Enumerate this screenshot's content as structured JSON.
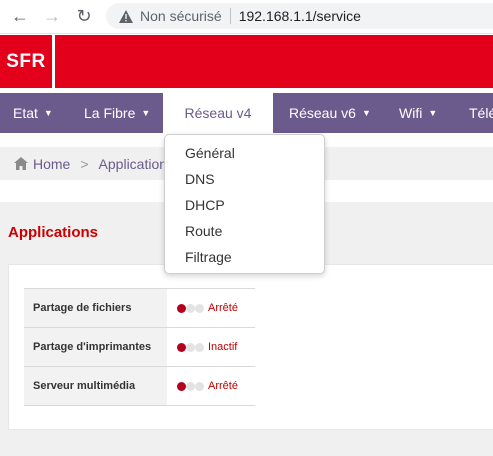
{
  "browser": {
    "security_label": "Non sécurisé",
    "url": "192.168.1.1/service"
  },
  "brand": {
    "logo_text": "SFR",
    "color": "#e2001a"
  },
  "nav": {
    "accent": "#6a5b8c",
    "items": [
      {
        "label": "Etat"
      },
      {
        "label": "La Fibre"
      },
      {
        "label": "Réseau v4"
      },
      {
        "label": "Réseau v6"
      },
      {
        "label": "Wifi"
      },
      {
        "label": "Télé"
      }
    ],
    "dropdown": [
      "Général",
      "DNS",
      "DHCP",
      "Route",
      "Filtrage"
    ]
  },
  "breadcrumb": {
    "home": "Home",
    "separator": ">",
    "current": "Applications"
  },
  "section": {
    "title": "Applications"
  },
  "apps": [
    {
      "name": "Partage de fichiers",
      "status": "Arrêté"
    },
    {
      "name": "Partage d'imprimantes",
      "status": "Inactif"
    },
    {
      "name": "Serveur multimédia",
      "status": "Arrêté"
    }
  ]
}
